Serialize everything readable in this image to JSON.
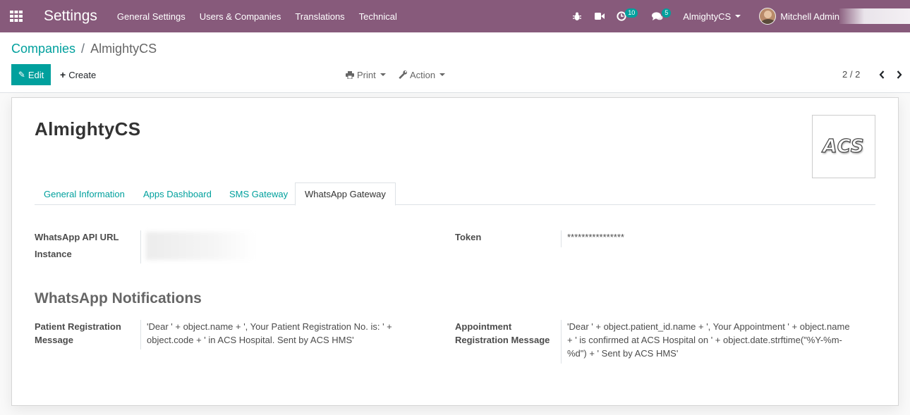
{
  "navbar": {
    "app_title": "Settings",
    "menu": [
      "General Settings",
      "Users & Companies",
      "Translations",
      "Technical"
    ],
    "activity_count": "10",
    "messages_count": "5",
    "company": "AlmightyCS",
    "user_name": "Mitchell Admin",
    "icons": [
      "apps-grid-icon",
      "bug-icon",
      "video-camera-icon",
      "clock-icon",
      "chat-icon"
    ]
  },
  "breadcrumb": {
    "parent": "Companies",
    "separator": "/",
    "current": "AlmightyCS"
  },
  "toolbar": {
    "edit_label": "Edit",
    "create_label": "Create",
    "print_label": "Print",
    "action_label": "Action"
  },
  "pager": {
    "value": "2 / 2"
  },
  "record": {
    "name": "AlmightyCS",
    "logo_text": "ACS"
  },
  "tabs": [
    {
      "label": "General Information",
      "active": false
    },
    {
      "label": "Apps Dashboard",
      "active": false
    },
    {
      "label": "SMS Gateway",
      "active": false
    },
    {
      "label": "WhatsApp Gateway",
      "active": true
    }
  ],
  "gateway": {
    "api_url_label": "WhatsApp API URL",
    "instance_label": "Instance",
    "token_label": "Token",
    "token_value": "****************"
  },
  "notifications": {
    "title": "WhatsApp Notifications",
    "patient_label": "Patient Registration Message",
    "patient_value": "'Dear ' + object.name + ', Your Patient Registration No. is: ' + object.code + ' in ACS Hospital. Sent by ACS HMS'",
    "appointment_label": "Appointment Registration Message",
    "appointment_value": "'Dear ' + object.patient_id.name + ', Your Appointment ' + object.name + ' is confirmed at ACS Hospital on ' + object.date.strftime(\"%Y-%m-%d\") + '  Sent by ACS HMS'"
  },
  "colors": {
    "navbar": "#875a7b",
    "accent": "#00a09d",
    "badge": "#00a09d"
  }
}
